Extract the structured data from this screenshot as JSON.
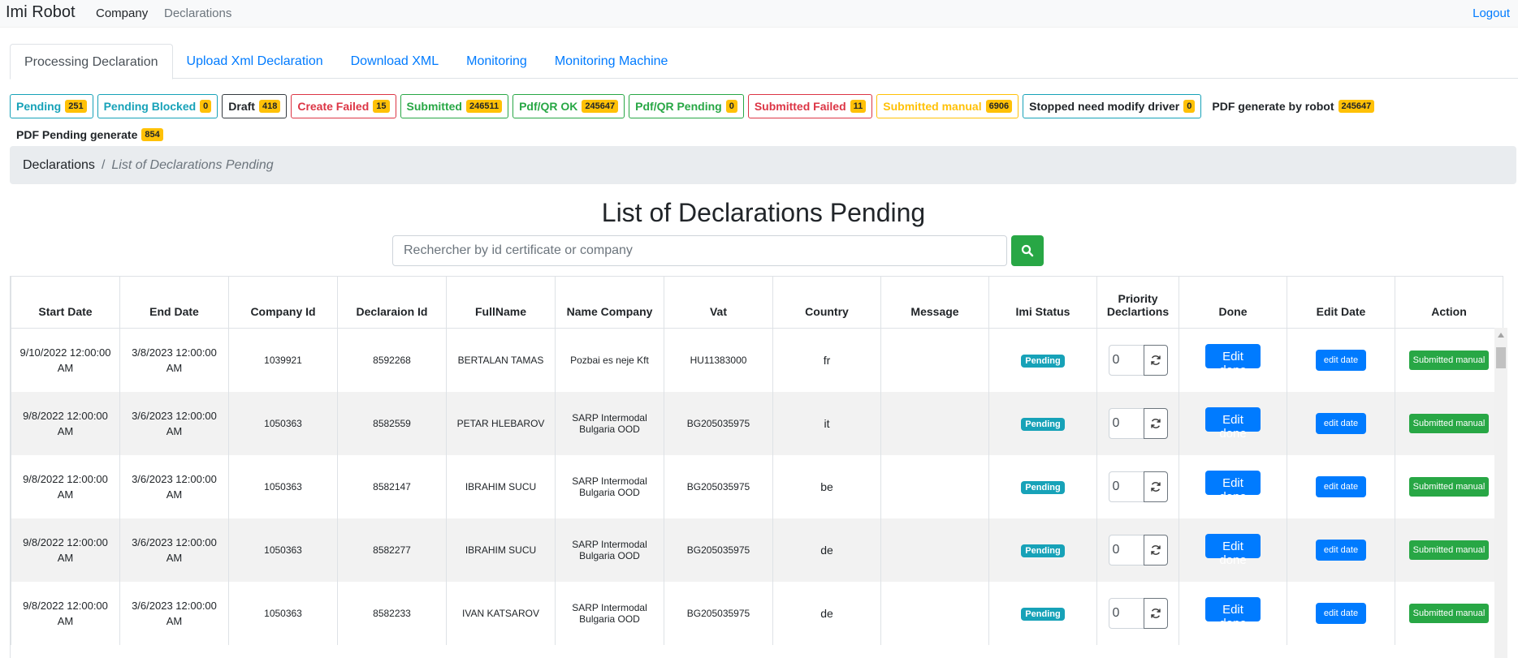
{
  "navbar": {
    "brand": "Imi Robot",
    "links": [
      "Company",
      "Declarations"
    ],
    "logout": "Logout"
  },
  "tabs": [
    "Processing Declaration",
    "Upload Xml Declaration",
    "Download XML",
    "Monitoring",
    "Monitoring Machine"
  ],
  "statuses": [
    {
      "label": "Pending",
      "count": "251"
    },
    {
      "label": "Pending Blocked",
      "count": "0"
    },
    {
      "label": "Draft",
      "count": "418"
    },
    {
      "label": "Create Failed",
      "count": "15"
    },
    {
      "label": "Submitted",
      "count": "246511"
    },
    {
      "label": "Pdf/QR OK",
      "count": "245647"
    },
    {
      "label": "Pdf/QR Pending",
      "count": "0"
    },
    {
      "label": "Submitted Failed",
      "count": "11"
    },
    {
      "label": "Submitted manual",
      "count": "6906"
    },
    {
      "label": "Stopped need modify driver",
      "count": "0"
    },
    {
      "label": "PDF generate by robot",
      "count": "245647"
    },
    {
      "label": "PDF Pending generate",
      "count": "854"
    }
  ],
  "breadcrumb": {
    "root": "Declarations",
    "separator": "/",
    "current": "List of Declarations Pending"
  },
  "page_title": "List of Declarations Pending",
  "search": {
    "placeholder": "Rechercher by id certificate or company"
  },
  "table": {
    "headers": [
      "Start Date",
      "End Date",
      "Company Id",
      "Declaraion Id",
      "FullName",
      "Name Company",
      "Vat",
      "Country",
      "Message",
      "Imi Status",
      "Priority Declartions",
      "Done",
      "Edit Date",
      "Action"
    ],
    "rows": [
      {
        "start": "9/10/2022 12:00:00 AM",
        "end": "3/8/2023 12:00:00 AM",
        "company_id": "1039921",
        "decl_id": "8592268",
        "fullname": "BERTALAN TAMAS",
        "company": "Pozbai es neje Kft",
        "vat": "HU11383000",
        "country": "fr",
        "message": "",
        "status": "Pending",
        "priority": "0"
      },
      {
        "start": "9/8/2022 12:00:00 AM",
        "end": "3/6/2023 12:00:00 AM",
        "company_id": "1050363",
        "decl_id": "8582559",
        "fullname": "PETAR HLEBAROV",
        "company": "SARP Intermodal Bulgaria OOD",
        "vat": "BG205035975",
        "country": "it",
        "message": "",
        "status": "Pending",
        "priority": "0"
      },
      {
        "start": "9/8/2022 12:00:00 AM",
        "end": "3/6/2023 12:00:00 AM",
        "company_id": "1050363",
        "decl_id": "8582147",
        "fullname": "IBRAHIM SUCU",
        "company": "SARP Intermodal Bulgaria OOD",
        "vat": "BG205035975",
        "country": "be",
        "message": "",
        "status": "Pending",
        "priority": "0"
      },
      {
        "start": "9/8/2022 12:00:00 AM",
        "end": "3/6/2023 12:00:00 AM",
        "company_id": "1050363",
        "decl_id": "8582277",
        "fullname": "IBRAHIM SUCU",
        "company": "SARP Intermodal Bulgaria OOD",
        "vat": "BG205035975",
        "country": "de",
        "message": "",
        "status": "Pending",
        "priority": "0"
      },
      {
        "start": "9/8/2022 12:00:00 AM",
        "end": "3/6/2023 12:00:00 AM",
        "company_id": "1050363",
        "decl_id": "8582233",
        "fullname": "IVAN KATSAROV",
        "company": "SARP Intermodal Bulgaria OOD",
        "vat": "BG205035975",
        "country": "de",
        "message": "",
        "status": "Pending",
        "priority": "0"
      }
    ],
    "buttons": {
      "edit_done": "Edit done",
      "edit_date": "edit date",
      "action": "Submitted manual"
    }
  },
  "colors": {
    "primary": "#007bff",
    "success": "#28a745",
    "info": "#17a2b8",
    "danger": "#dc3545",
    "warning": "#ffc107"
  }
}
